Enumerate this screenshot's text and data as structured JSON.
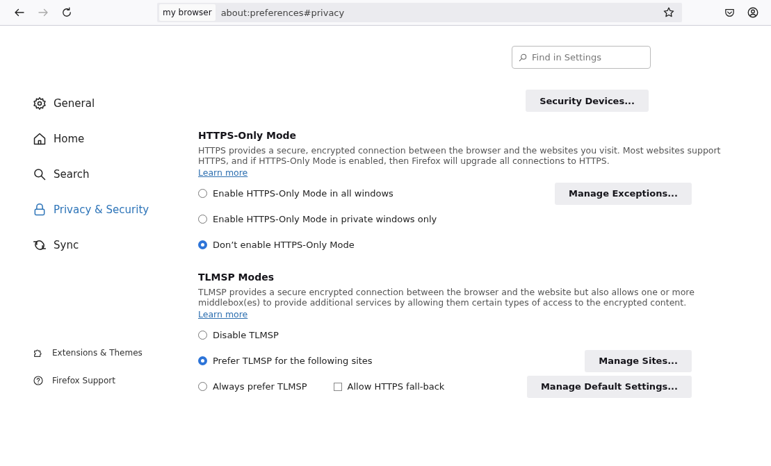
{
  "toolbar": {
    "identity": "my browser",
    "url": "about:preferences#privacy"
  },
  "search": {
    "placeholder": "Find in Settings"
  },
  "sidebar": {
    "items": [
      {
        "label": "General",
        "kind": "gear",
        "selected": false
      },
      {
        "label": "Home",
        "kind": "home",
        "selected": false
      },
      {
        "label": "Search",
        "kind": "search",
        "selected": false
      },
      {
        "label": "Privacy & Security",
        "kind": "lock",
        "selected": true
      },
      {
        "label": "Sync",
        "kind": "sync",
        "selected": false
      }
    ],
    "footer_items": [
      {
        "label": "Extensions & Themes",
        "kind": "puzzle"
      },
      {
        "label": "Firefox Support",
        "kind": "help"
      }
    ]
  },
  "security_devices_button": "Security Devices...",
  "sections": [
    {
      "title": "HTTPS-Only Mode",
      "description": "HTTPS provides a secure, encrypted connection between the browser and the websites you visit. Most websites support HTTPS, and if HTTPS-Only Mode is enabled, then Firefox will upgrade all connections to HTTPS.",
      "link": "Learn more",
      "options": [
        {
          "label": "Enable HTTPS-Only Mode in all windows",
          "selected": false,
          "button": "Manage Exceptions..."
        },
        {
          "label": "Enable HTTPS-Only Mode in private windows only",
          "selected": false
        },
        {
          "label": "Don’t enable HTTPS-Only Mode",
          "selected": true
        }
      ]
    },
    {
      "title": "TLMSP Modes",
      "description": "TLMSP provides a secure encrypted connection between the browser and the website but also allows one or more middlebox(es) to provide additional services by allowing them certain types of access to the encrypted content.",
      "link": "Learn more",
      "options": [
        {
          "label": "Disable TLMSP",
          "selected": false
        },
        {
          "label": "Prefer TLMSP for the following sites",
          "selected": true,
          "button": "Manage Sites..."
        },
        {
          "label": "Always prefer TLMSP",
          "selected": false,
          "checkbox": {
            "label": "Allow HTTPS fall-back",
            "checked": false
          },
          "button": "Manage Default Settings..."
        }
      ]
    }
  ]
}
